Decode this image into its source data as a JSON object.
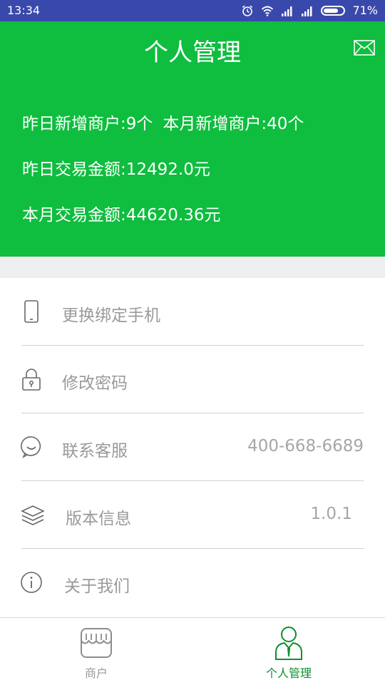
{
  "status_bar": {
    "time": "13:34",
    "battery": "71%"
  },
  "header": {
    "title": "个人管理",
    "stats": {
      "yesterday_new_merchants": "昨日新增商户:9个",
      "month_new_merchants": "本月新增商户:40个",
      "yesterday_amount": "昨日交易金额:12492.0元",
      "month_amount": "本月交易金额:44620.36元"
    }
  },
  "menu": {
    "items": [
      {
        "label": "更换绑定手机",
        "value": "",
        "icon": "phone-icon"
      },
      {
        "label": "修改密码",
        "value": "",
        "icon": "lock-icon"
      },
      {
        "label": "联系客服",
        "value": "400-668-6689",
        "icon": "chat-bubble-icon"
      },
      {
        "label": "版本信息",
        "value": "1.0.1",
        "icon": "layers-icon"
      },
      {
        "label": "关于我们",
        "value": "",
        "icon": "info-icon"
      }
    ]
  },
  "bottom_nav": {
    "tabs": [
      {
        "label": "商户",
        "icon": "storefront-icon",
        "active": false
      },
      {
        "label": "个人管理",
        "icon": "person-icon",
        "active": true
      }
    ]
  },
  "colors": {
    "header_green": "#0fbd3f",
    "status_bar": "#3949ab",
    "active_tab": "#0d8f2e",
    "inactive_text": "#9a9a9a"
  }
}
